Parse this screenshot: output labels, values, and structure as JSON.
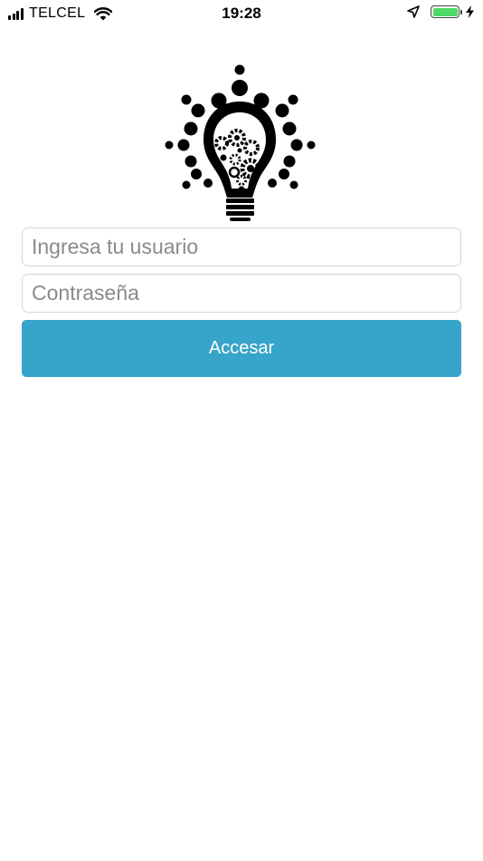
{
  "status_bar": {
    "carrier": "TELCEL",
    "time": "19:28",
    "icons": [
      "signal-icon",
      "wifi-icon",
      "location-arrow-icon",
      "battery-icon",
      "charging-bolt-icon"
    ],
    "battery_color": "#4cd964",
    "battery_level": 1.0
  },
  "logo": {
    "icon": "lightbulb-gears-logo"
  },
  "login": {
    "username_placeholder": "Ingresa tu usuario",
    "username_value": "",
    "password_placeholder": "Contraseña",
    "password_value": "",
    "submit_label": "Accesar"
  },
  "colors": {
    "accent": "#37a4c9",
    "field_border": "#d6d6d6",
    "placeholder": "#8a8a8a"
  }
}
